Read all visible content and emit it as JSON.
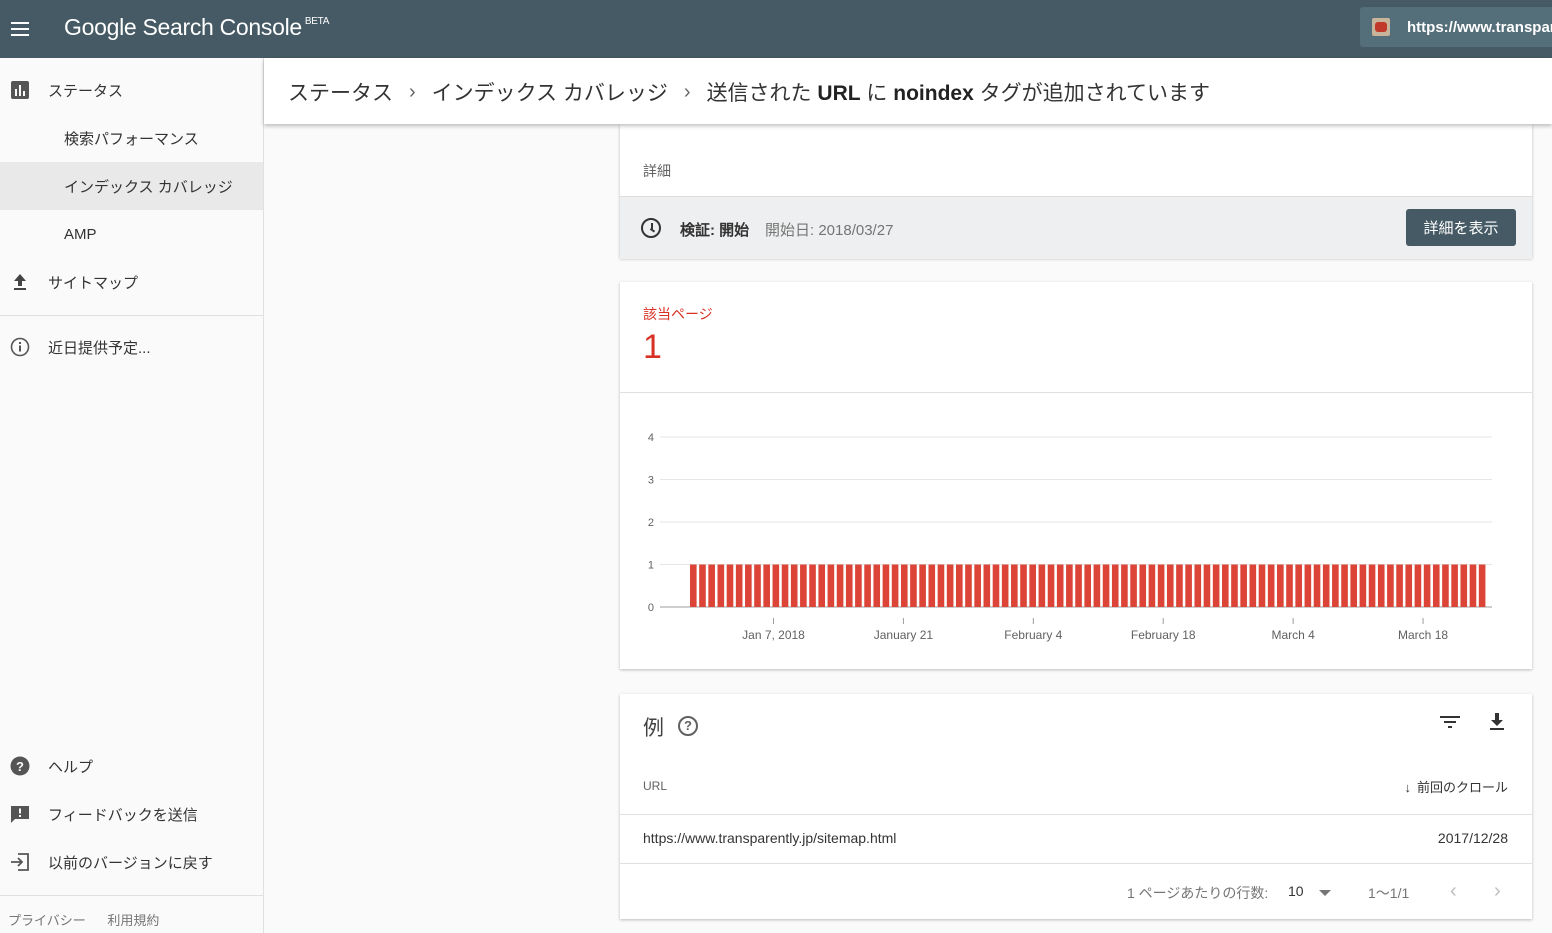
{
  "app": {
    "title": "Google Search Console",
    "badge": "BETA",
    "property_url": "https://www.transpare"
  },
  "sidebar": {
    "items": [
      {
        "label": "ステータス",
        "icon": "bar-chart-icon"
      },
      {
        "label": "検索パフォーマンス"
      },
      {
        "label": "インデックス カバレッジ",
        "active": true
      },
      {
        "label": "AMP"
      },
      {
        "label": "サイトマップ",
        "icon": "upload-icon"
      },
      {
        "label": "近日提供予定...",
        "icon": "info-icon"
      }
    ],
    "bottom_items": [
      {
        "label": "ヘルプ",
        "icon": "help-icon"
      },
      {
        "label": "フィードバックを送信",
        "icon": "feedback-icon"
      },
      {
        "label": "以前のバージョンに戻す",
        "icon": "exit-icon"
      }
    ],
    "footer": {
      "privacy": "プライバシー",
      "terms": "利用規約"
    }
  },
  "breadcrumb": {
    "items": [
      "ステータス",
      "インデックス カバレッジ"
    ],
    "current_parts": [
      "送信された ",
      "URL",
      " に ",
      "noindex",
      " タグが追加されています"
    ]
  },
  "details_card": {
    "label": "詳細",
    "validation_status": "検証: 開始",
    "start_date": "開始日: 2018/03/27",
    "button": "詳細を表示"
  },
  "summary": {
    "label": "該当ページ",
    "value": "1",
    "accent_color": "#d93025"
  },
  "chart_data": {
    "type": "bar",
    "x_range": [
      "2017-12-29",
      "2018-03-25"
    ],
    "tick_labels": [
      "Jan 7, 2018",
      "January 21",
      "February 4",
      "February 18",
      "March 4",
      "March 18"
    ],
    "y_ticks": [
      0,
      1,
      2,
      3,
      4
    ],
    "ylim": [
      0,
      4
    ],
    "values": [
      1,
      1,
      1,
      1,
      1,
      1,
      1,
      1,
      1,
      1,
      1,
      1,
      1,
      1,
      1,
      1,
      1,
      1,
      1,
      1,
      1,
      1,
      1,
      1,
      1,
      1,
      1,
      1,
      1,
      1,
      1,
      1,
      1,
      1,
      1,
      1,
      1,
      1,
      1,
      1,
      1,
      1,
      1,
      1,
      1,
      1,
      1,
      1,
      1,
      1,
      1,
      1,
      1,
      1,
      1,
      1,
      1,
      1,
      1,
      1,
      1,
      1,
      1,
      1,
      1,
      1,
      1,
      1,
      1,
      1,
      1,
      1,
      1,
      1,
      1,
      1,
      1,
      1,
      1,
      1,
      1,
      1,
      1,
      1,
      1,
      1,
      1
    ],
    "bar_color": "#db4437",
    "grid": true
  },
  "examples": {
    "title": "例",
    "help": "?",
    "columns": {
      "url": "URL",
      "last_crawl": "前回のクロール"
    },
    "rows": [
      {
        "url": "https://www.transparently.jp/sitemap.html",
        "last_crawl": "2017/12/28"
      }
    ],
    "pagination": {
      "rows_label": "1 ページあたりの行数:",
      "rows_value": "10",
      "range": "1〜1/1",
      "prev": "‹",
      "next": "›"
    }
  }
}
